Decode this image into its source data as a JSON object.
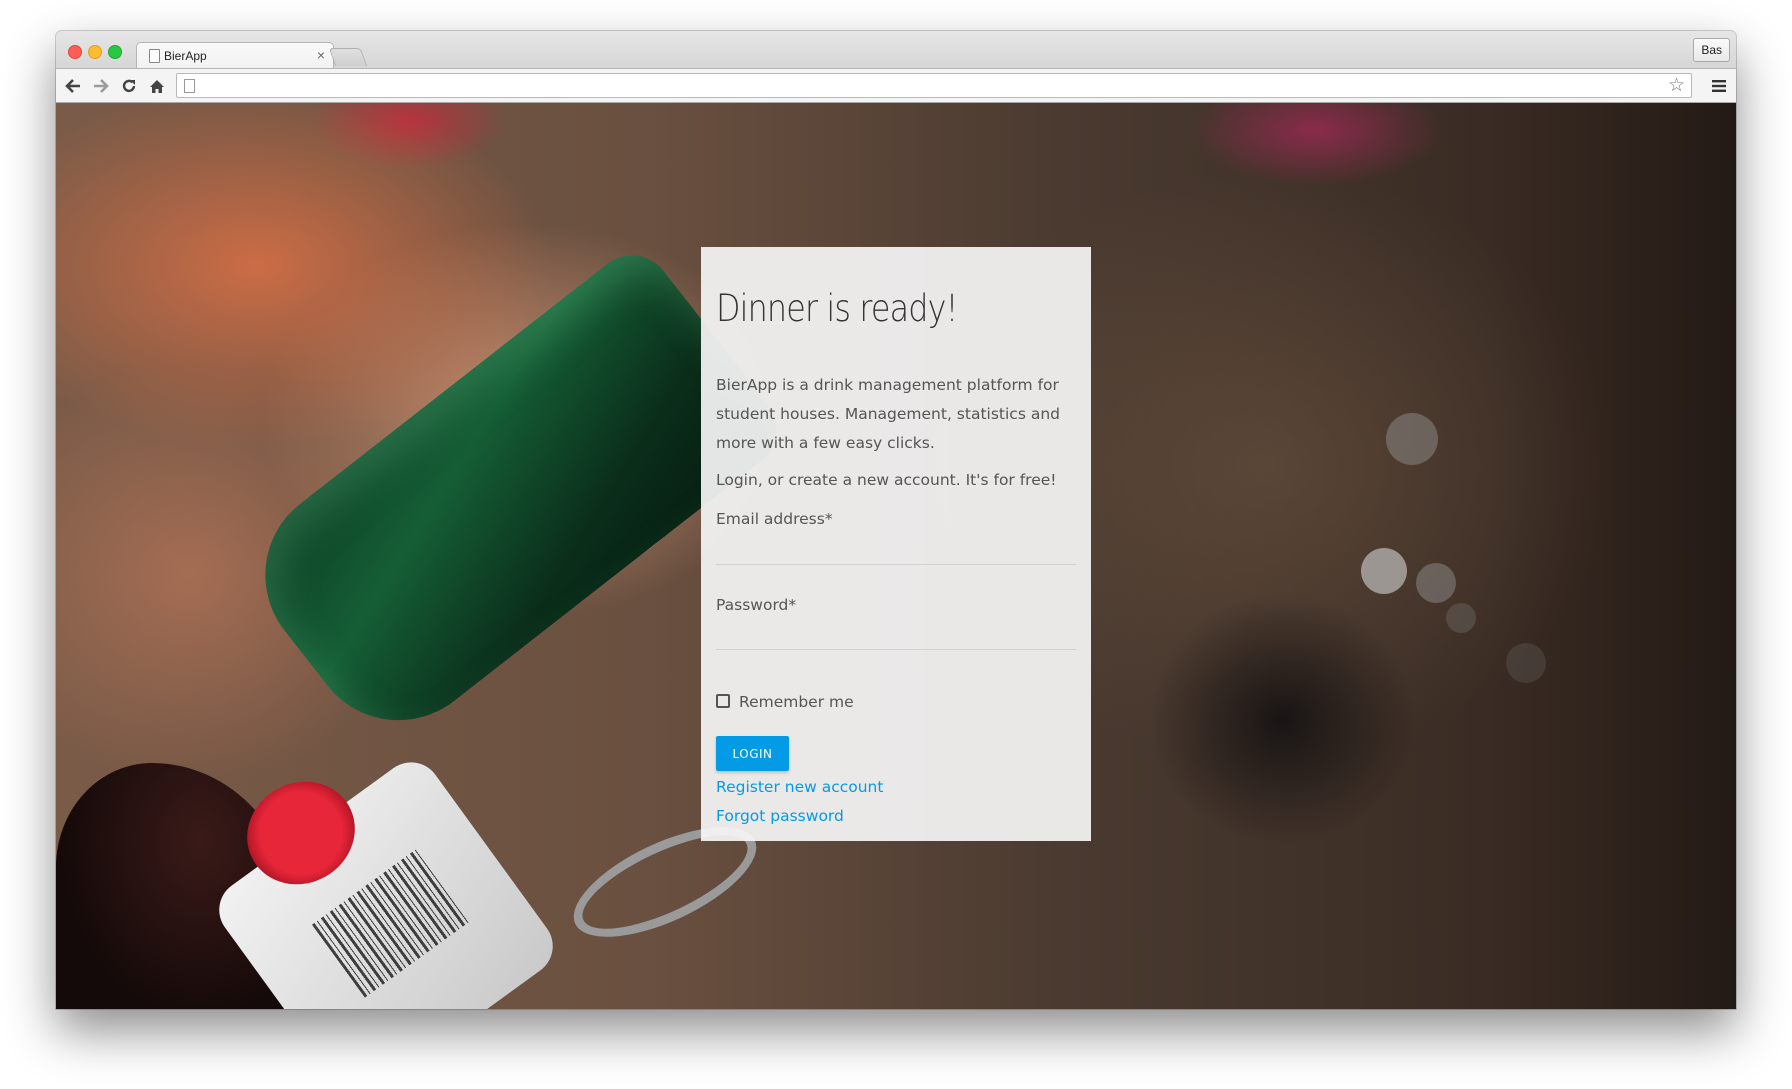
{
  "browser": {
    "tab": {
      "title": "BierApp",
      "close_glyph": "×"
    },
    "profile_label": "Bas",
    "address": {
      "value": "",
      "placeholder": ""
    },
    "icons": {
      "back": "arrow-left-icon",
      "forward": "arrow-right-icon",
      "reload": "reload-icon",
      "home": "home-icon",
      "star": "star-icon",
      "menu": "hamburger-menu-icon"
    },
    "star_glyph": "☆"
  },
  "login_card": {
    "title": "Dinner is ready!",
    "intro": "BierApp is a drink management platform for student houses. Management, statistics and more with a few easy clicks.",
    "tagline": "Login, or create a new account. It's for free!",
    "email_label": "Email address*",
    "email_value": "",
    "password_label": "Password*",
    "password_value": "",
    "remember_label": "Remember me",
    "remember_checked": false,
    "login_button": "LOGIN",
    "register_link": "Register new account",
    "forgot_link": "Forgot password"
  },
  "colors": {
    "accent": "#039be5",
    "card_background": "#f5f5f5",
    "text": "#555555"
  }
}
